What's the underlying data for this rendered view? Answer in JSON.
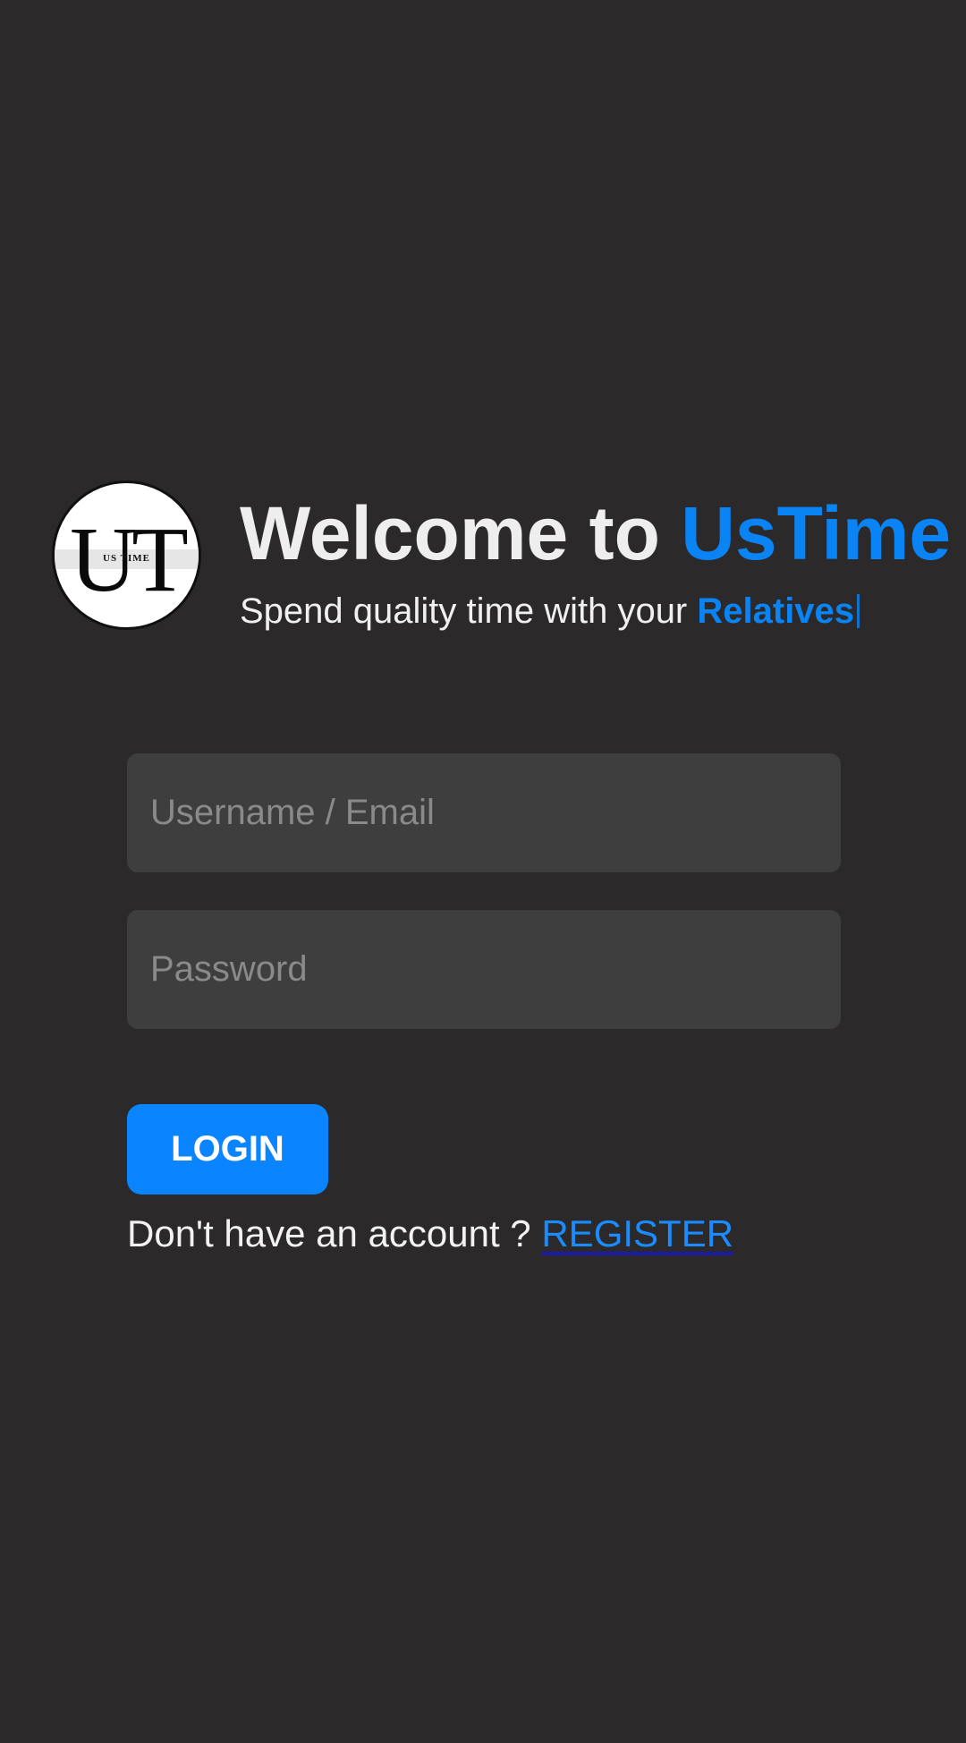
{
  "logo": {
    "letters": "UT",
    "small_text": "US TIME"
  },
  "header": {
    "title_prefix": "Welcome to ",
    "title_brand": "UsTime",
    "subtitle_prefix": "Spend quality time with your ",
    "subtitle_word": "Relatives"
  },
  "form": {
    "username_placeholder": "Username / Email",
    "password_placeholder": "Password",
    "login_label": "LOGIN"
  },
  "register": {
    "prompt": "Don't have an account ? ",
    "link_label": "REGISTER"
  },
  "colors": {
    "background": "#2b292a",
    "accent": "#0a84ff",
    "input_background": "#3e3e3e"
  }
}
